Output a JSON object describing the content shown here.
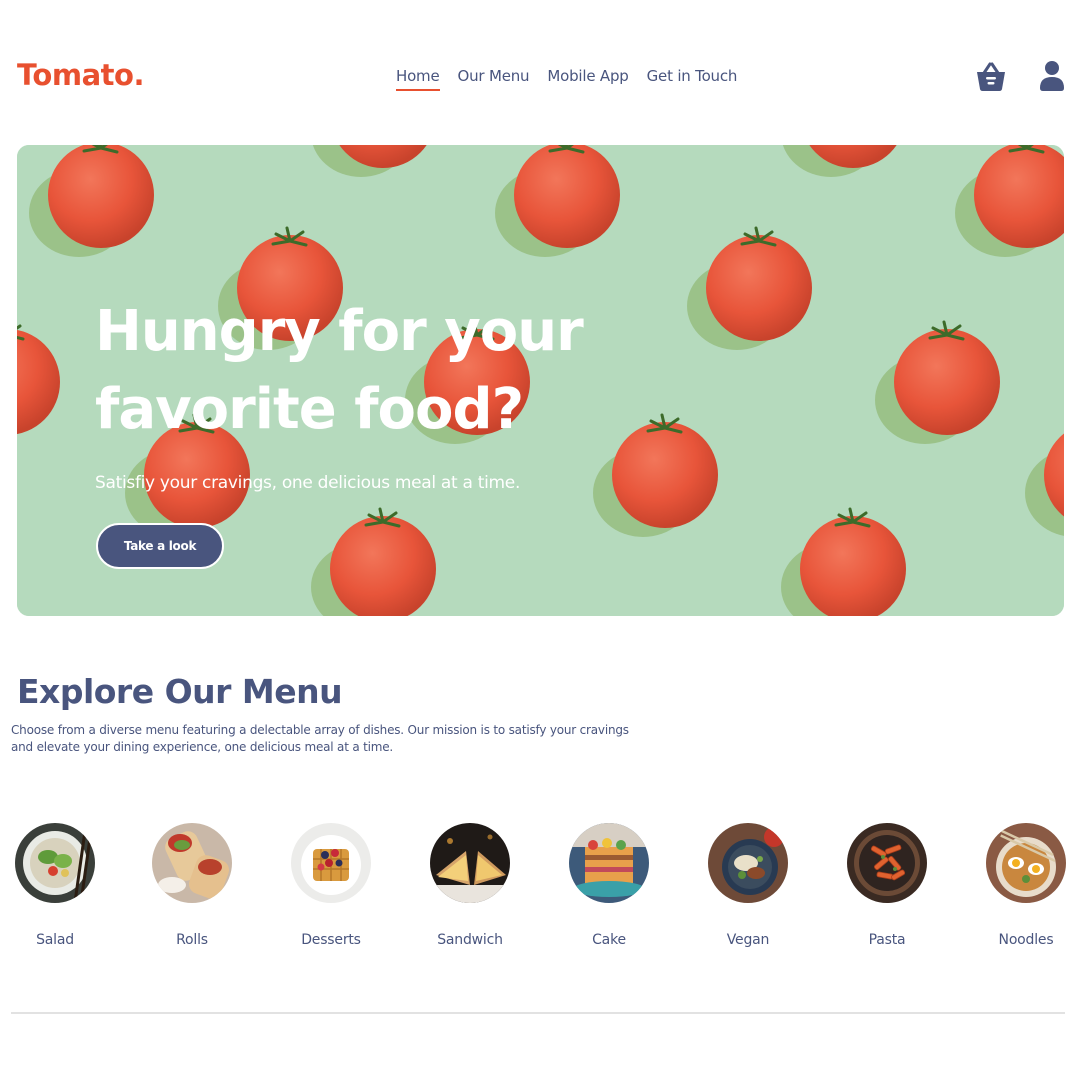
{
  "brand": {
    "logo_text": "Tomato",
    "logo_dot": "."
  },
  "nav": {
    "links": [
      {
        "label": "Home",
        "active": true
      },
      {
        "label": "Our Menu",
        "active": false
      },
      {
        "label": "Mobile App",
        "active": false
      },
      {
        "label": "Get in Touch",
        "active": false
      }
    ],
    "icons": [
      "basket-icon",
      "user-icon"
    ]
  },
  "hero": {
    "title": "Hungry for your\nfavorite food?",
    "subtitle": "Satisfiy your cravings, one delicious meal at a time.",
    "button_label": "Take a look"
  },
  "explore": {
    "title": "Explore Our Menu",
    "text": "Choose from a diverse menu featuring a delectable array of dishes. Our mission is to satisfy your cravings and elevate your dining experience, one delicious meal at a time.",
    "items": [
      {
        "label": "Salad"
      },
      {
        "label": "Rolls"
      },
      {
        "label": "Desserts"
      },
      {
        "label": "Sandwich"
      },
      {
        "label": "Cake"
      },
      {
        "label": "Vegan"
      },
      {
        "label": "Pasta"
      },
      {
        "label": "Noodles"
      }
    ]
  },
  "colors": {
    "brand": "#e8502f",
    "text": "#49557e",
    "hero_bg": "#b5dabd",
    "tomato": "#e8553a"
  }
}
